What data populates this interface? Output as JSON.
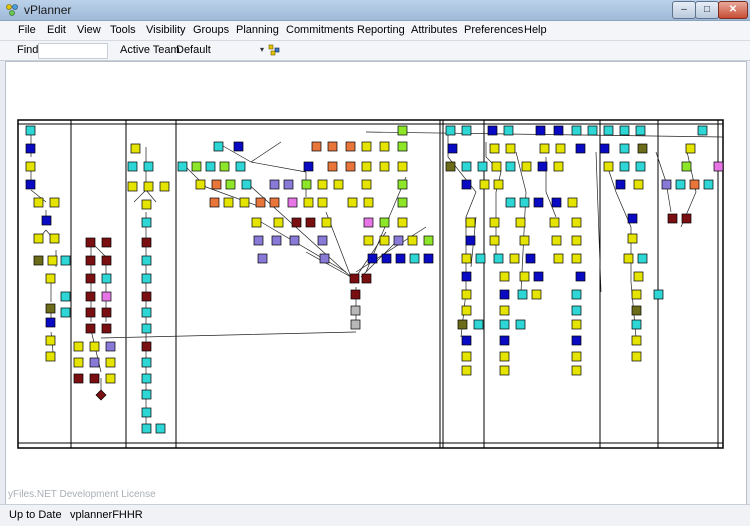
{
  "window": {
    "title": "vPlanner",
    "controls": {
      "minimize": "–",
      "maximize": "□",
      "close": "✕"
    }
  },
  "menu": {
    "items": [
      "File",
      "Edit",
      "View",
      "Tools",
      "Visibility",
      "Groups",
      "Planning",
      "Commitments",
      "Reporting",
      "Attributes",
      "Preferences",
      "Help"
    ]
  },
  "toolbar": {
    "find_label": "Find",
    "find_value": "",
    "team_label": "Active Team",
    "team_value": "Default",
    "team_arrow": "▾"
  },
  "canvas": {
    "watermark": "yFiles.NET Development License"
  },
  "status": {
    "state": "Up to Date",
    "project": "vplannerFHHR"
  },
  "colors": {
    "navy": "#0a0ac2",
    "yellow": "#e4e400",
    "cyan": "#2fd6d6",
    "maroon": "#7a0f12",
    "orange": "#e8763a",
    "lime": "#8ee62a",
    "purple": "#8a7ad8",
    "magenta": "#e676e6",
    "olive": "#6b6b1a",
    "gray": "#b8b8b8"
  }
}
